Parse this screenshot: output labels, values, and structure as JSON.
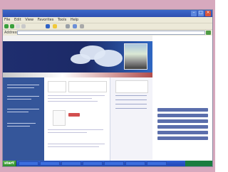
{
  "window": {
    "title": "",
    "controls": {
      "minimize": "–",
      "maximize": "□",
      "close": "×"
    }
  },
  "browser": {
    "menu": [
      "File",
      "Edit",
      "View",
      "Favorites",
      "Tools",
      "Help"
    ],
    "address_label": "Address",
    "address_value": "",
    "go_label": ""
  },
  "site": {
    "nav": [
      "",
      "",
      "",
      "",
      ""
    ],
    "header_title": "",
    "hero_image_description": "photo"
  },
  "taskbar": {
    "start_label": "start",
    "clock": ""
  },
  "colors": {
    "titlebar": "#2f4fb0",
    "site_header": "#1f2e6f",
    "site_left": "#35569a",
    "accent_red": "#d24f4f",
    "taskbar": "#1f46b8",
    "start_green": "#2d8f2c"
  },
  "icons": {
    "back": "back-icon",
    "forward": "forward-icon",
    "refresh": "refresh-icon",
    "home": "home-icon",
    "search": "search-icon",
    "favorites": "star-icon",
    "go": "go-icon"
  }
}
